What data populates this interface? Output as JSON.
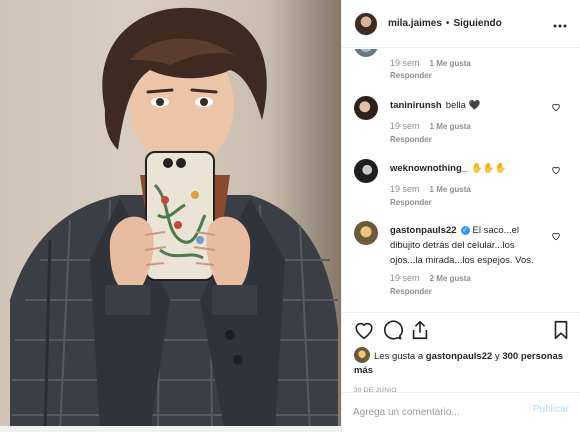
{
  "header": {
    "username": "mila.jaimes",
    "separator": "•",
    "follow_state": "Siguiendo",
    "more_icon": "more-horizontal-icon"
  },
  "comments": {
    "partial": {
      "age": "19 sem",
      "likes": "1 Me gusta",
      "reply": "Responder"
    },
    "items": [
      {
        "username": "taninirunsh",
        "text": "bella 🖤",
        "age": "19 sem",
        "likes": "1 Me gusta",
        "reply": "Responder"
      },
      {
        "username": "weknownothing_",
        "text": "✋✋✋",
        "age": "19 sem",
        "likes": "1 Me gusta",
        "reply": "Responder"
      },
      {
        "username": "gastonpauls22",
        "verified_mark": "✓",
        "text": "El saco...el dibujito detrás del celular...los ojos...la mirada...los espejos. Vos.",
        "age": "19 sem",
        "likes": "2 Me gusta",
        "reply": "Responder"
      }
    ]
  },
  "actions": {
    "like_icon": "heart-icon",
    "comment_icon": "comment-icon",
    "share_icon": "share-icon",
    "save_icon": "bookmark-icon"
  },
  "likes_summary": {
    "prefix": "Les gusta a ",
    "user": "gastonpauls22",
    "middle": " y ",
    "others": "300 personas más"
  },
  "post_date": "30 DE JUNIO",
  "compose": {
    "placeholder": "Agrega un comentario...",
    "post_label": "Publicar"
  },
  "colors": {
    "link_blue": "#3897f0",
    "post_disabled": "#b2dffc",
    "muted": "#8e8e8e",
    "text": "#262626"
  }
}
